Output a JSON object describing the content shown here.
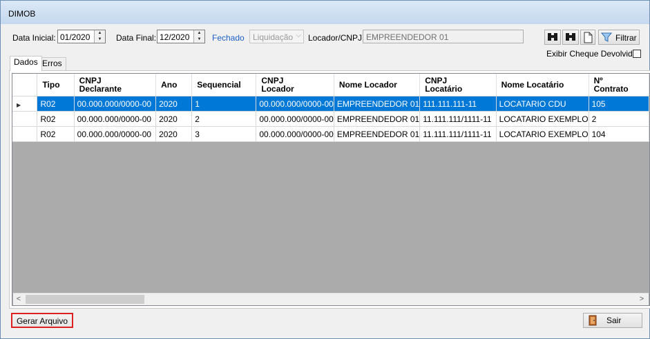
{
  "window": {
    "title": "DIMOB"
  },
  "filters": {
    "data_inicial_label": "Data Inicial:",
    "data_inicial_value": "01/2020",
    "data_final_label": "Data Final:",
    "data_final_value": "12/2020",
    "status_text": "Fechado",
    "tipo_value": "Liquidação",
    "locador_label": "Locador/CNPJ:",
    "locador_value": "EMPREENDEDOR 01",
    "filtrar_label": "Filtrar",
    "exibir_cheque_label": "Exibir Cheque Devolvido",
    "status_color": "#1c5fc9"
  },
  "tabs": [
    {
      "label": "Dados"
    },
    {
      "label": "Erros"
    }
  ],
  "grid": {
    "columns": [
      {
        "line1": "Tipo",
        "line2": ""
      },
      {
        "line1": "CNPJ",
        "line2": "Declarante"
      },
      {
        "line1": "Ano",
        "line2": ""
      },
      {
        "line1": "Sequencial",
        "line2": ""
      },
      {
        "line1": "CNPJ",
        "line2": "Locador"
      },
      {
        "line1": "Nome Locador",
        "line2": ""
      },
      {
        "line1": "CNPJ",
        "line2": "Locatário"
      },
      {
        "line1": "Nome Locatário",
        "line2": ""
      },
      {
        "line1": "Nº",
        "line2": "Contrato"
      }
    ],
    "rows": [
      [
        "R02",
        "00.000.000/0000-00",
        "2020",
        "1",
        "00.000.000/0000-00",
        "EMPREENDEDOR 01",
        "111.111.111-11",
        "LOCATARIO CDU",
        "105"
      ],
      [
        "R02",
        "00.000.000/0000-00",
        "2020",
        "2",
        "00.000.000/0000-00",
        "EMPREENDEDOR 01",
        "11.111.111/1111-11",
        "LOCATARIO EXEMPLO",
        "2"
      ],
      [
        "R02",
        "00.000.000/0000-00",
        "2020",
        "3",
        "00.000.000/0000-00",
        "EMPREENDEDOR 01",
        "11.111.111/1111-11",
        "LOCATARIO EXEMPLO",
        "104"
      ]
    ],
    "selection_color": "#0078d7"
  },
  "footer": {
    "gerar_label": "Gerar Arquivo",
    "sair_label": "Sair"
  }
}
